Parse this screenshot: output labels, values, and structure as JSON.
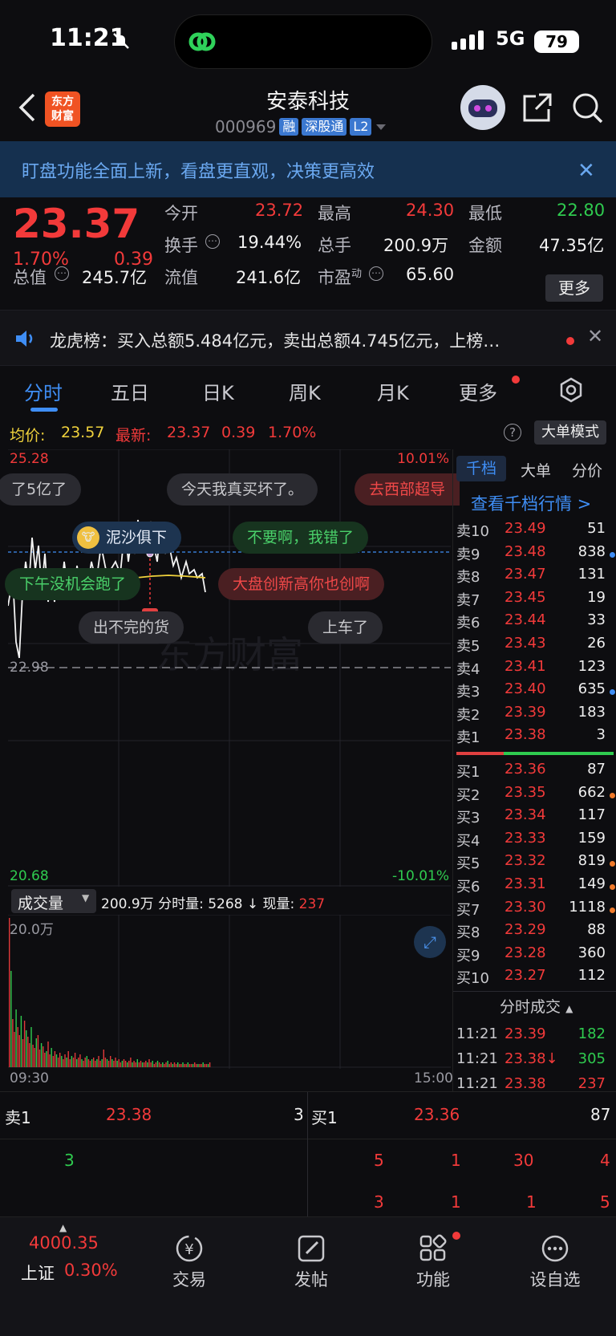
{
  "status": {
    "time": "11:21",
    "network": "5G",
    "battery": "79"
  },
  "header": {
    "logo_line1": "东方",
    "logo_line2": "财富",
    "title": "安泰科技",
    "code": "000969",
    "tags": [
      "融",
      "深股通",
      "L2"
    ]
  },
  "banner": {
    "text": "盯盘功能全面上新，看盘更直观，决策更高效"
  },
  "quote": {
    "price": "23.37",
    "pct": "1.70%",
    "change": "0.39",
    "items": [
      {
        "label": "今开",
        "value": "23.72",
        "color": "#f23a3a"
      },
      {
        "label": "最高",
        "value": "24.30",
        "color": "#f23a3a"
      },
      {
        "label": "最低",
        "value": "22.80",
        "color": "#2fcb4f"
      },
      {
        "label": "换手",
        "value": "19.44%",
        "color": "#f1f1f1"
      },
      {
        "label": "总手",
        "value": "200.9万",
        "color": "#f1f1f1"
      },
      {
        "label": "金额",
        "value": "47.35亿",
        "color": "#f1f1f1"
      },
      {
        "label": "总值",
        "value": "245.7亿",
        "color": "#f1f1f1"
      },
      {
        "label": "流值",
        "value": "241.6亿",
        "color": "#f1f1f1"
      },
      {
        "label": "市盈",
        "sup": "动",
        "value": "65.60",
        "color": "#f1f1f1"
      }
    ],
    "more": "更多"
  },
  "news": {
    "text": "龙虎榜：买入总额5.484亿元，卖出总额4.745亿元，上榜…"
  },
  "tabs": [
    "分时",
    "五日",
    "日K",
    "周K",
    "月K",
    "更多"
  ],
  "info": {
    "avg_label": "均价:",
    "avg": "23.57",
    "latest_label": "最新:",
    "latest": "23.37",
    "change": "0.39",
    "pct": "1.70%",
    "big_mode": "大单模式"
  },
  "chart": {
    "top_price": "25.28",
    "top_pct": "10.01%",
    "bottom_price": "20.68",
    "bottom_pct": "-10.01%",
    "mid_price": "22.98",
    "buy_mark": "B",
    "watermark": "东方财富",
    "bubbles": [
      {
        "text": "了5亿了",
        "style": "b-gray"
      },
      {
        "text": "今天我真买坏了。",
        "style": "b-gray"
      },
      {
        "text": "去西部超导",
        "style": "b-red"
      },
      {
        "text": "泥沙俱下",
        "style": "b-blue"
      },
      {
        "text": "不要啊，我错了",
        "style": "b-green"
      },
      {
        "text": "下午没机会跑了",
        "style": "b-green"
      },
      {
        "text": "大盘创新高你也创啊",
        "style": "b-red"
      },
      {
        "text": "出不完的货",
        "style": "b-gray"
      },
      {
        "text": "上车了",
        "style": "b-gray"
      }
    ]
  },
  "volume": {
    "label": "成交量",
    "total": "200.9万",
    "detail": "分时量: 5268 ↓ 现量:",
    "now": "237",
    "scale": "20.0万",
    "start": "09:30",
    "end": "15:00"
  },
  "book": {
    "tabs": [
      "千档",
      "大单",
      "分价"
    ],
    "link": "查看千档行情 >",
    "asks": [
      {
        "label": "卖10",
        "price": "23.49",
        "qty": "51",
        "dot": ""
      },
      {
        "label": "卖9",
        "price": "23.48",
        "qty": "838",
        "dot": "#3f8ef5"
      },
      {
        "label": "卖8",
        "price": "23.47",
        "qty": "131",
        "dot": ""
      },
      {
        "label": "卖7",
        "price": "23.45",
        "qty": "19",
        "dot": ""
      },
      {
        "label": "卖6",
        "price": "23.44",
        "qty": "33",
        "dot": ""
      },
      {
        "label": "卖5",
        "price": "23.43",
        "qty": "26",
        "dot": ""
      },
      {
        "label": "卖4",
        "price": "23.41",
        "qty": "123",
        "dot": ""
      },
      {
        "label": "卖3",
        "price": "23.40",
        "qty": "635",
        "dot": "#3f8ef5"
      },
      {
        "label": "卖2",
        "price": "23.39",
        "qty": "183",
        "dot": ""
      },
      {
        "label": "卖1",
        "price": "23.38",
        "qty": "3",
        "dot": ""
      }
    ],
    "bids": [
      {
        "label": "买1",
        "price": "23.36",
        "qty": "87",
        "dot": ""
      },
      {
        "label": "买2",
        "price": "23.35",
        "qty": "662",
        "dot": "#f07a2a"
      },
      {
        "label": "买3",
        "price": "23.34",
        "qty": "117",
        "dot": ""
      },
      {
        "label": "买4",
        "price": "23.33",
        "qty": "159",
        "dot": ""
      },
      {
        "label": "买5",
        "price": "23.32",
        "qty": "819",
        "dot": "#f07a2a"
      },
      {
        "label": "买6",
        "price": "23.31",
        "qty": "149",
        "dot": "#f07a2a"
      },
      {
        "label": "买7",
        "price": "23.30",
        "qty": "1118",
        "dot": "#f07a2a"
      },
      {
        "label": "买8",
        "price": "23.29",
        "qty": "88",
        "dot": ""
      },
      {
        "label": "买9",
        "price": "23.28",
        "qty": "360",
        "dot": ""
      },
      {
        "label": "买10",
        "price": "23.27",
        "qty": "112",
        "dot": ""
      }
    ],
    "trades_title": "分时成交",
    "trades": [
      {
        "time": "11:21",
        "price": "23.39",
        "qty": "182",
        "qcolor": "#2fcb4f"
      },
      {
        "time": "11:21",
        "price": "23.38↓",
        "qty": "305",
        "qcolor": "#2fcb4f"
      },
      {
        "time": "11:21",
        "price": "23.38",
        "qty": "237",
        "qcolor": "#f23a3a"
      }
    ]
  },
  "level1": {
    "sell_label": "卖1",
    "sell_price": "23.38",
    "sell_qty": "3",
    "buy_label": "买1",
    "buy_price": "23.36",
    "buy_qty": "87",
    "sell_queue": [
      "3"
    ],
    "buy_queue_row1": [
      "5",
      "1",
      "30",
      "4"
    ],
    "buy_queue_row2": [
      "3",
      "1",
      "1",
      "5"
    ]
  },
  "nav": {
    "index_value": "4000.35",
    "index_name": "上证",
    "index_pct": "0.30%",
    "items": [
      "交易",
      "发帖",
      "功能",
      "设自选"
    ]
  }
}
